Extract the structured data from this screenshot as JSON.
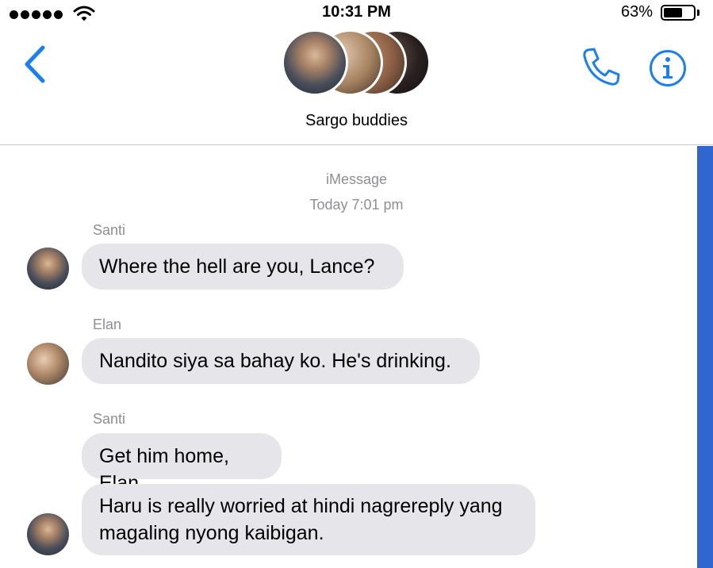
{
  "status_bar": {
    "time": "10:31 PM",
    "battery": "63%",
    "battery_level": 0.63,
    "signal_icon": "signal-dots-icon",
    "wifi_icon": "wifi-icon"
  },
  "header": {
    "group_name": "Sargo buddies",
    "back_icon": "chevron-left-icon",
    "call_icon": "phone-icon",
    "info_icon": "info-icon"
  },
  "conversation": {
    "service": "iMessage",
    "timestamp": "Today 7:01 pm",
    "messages": [
      {
        "sender": "Santi",
        "text": "Where the hell are you, Lance?"
      },
      {
        "sender": "Elan",
        "text": "Nandito siya sa bahay ko. He's drinking."
      },
      {
        "sender": "Santi",
        "text": "Get him home, Elan."
      },
      {
        "sender": "",
        "text": "Haru is really worried at hindi nagrereply yang magaling nyong kaibigan."
      }
    ]
  },
  "colors": {
    "accent": "#1a7ef5",
    "bubble": "#e5e5ea",
    "scrollbar": "#2f66d0"
  }
}
